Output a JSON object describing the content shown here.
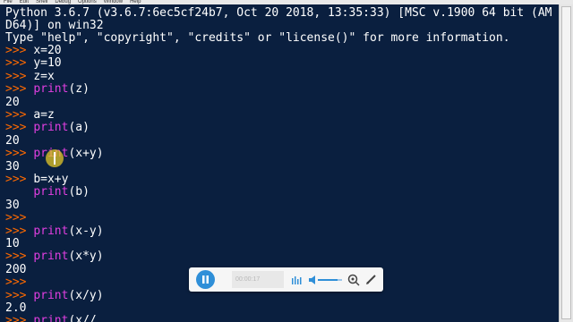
{
  "menubar": {
    "items": [
      "File",
      "Edit",
      "Shell",
      "Debug",
      "Options",
      "Window",
      "Help"
    ]
  },
  "shell": {
    "banner_line1": "Python 3.6.7 (v3.6.7:6ec5cf24b7, Oct 20 2018, 13:35:33) [MSC v.1900 64 bit (AM",
    "banner_line2": "D64)] on win32",
    "banner_line3": "Type \"help\", \"copyright\", \"credits\" or \"license()\" for more information.",
    "prompt": ">>> ",
    "lines": [
      {
        "type": "input",
        "code": "x=20"
      },
      {
        "type": "input",
        "code": "y=10"
      },
      {
        "type": "input",
        "code": "z=x"
      },
      {
        "type": "input",
        "kw": "print",
        "code": "(z)"
      },
      {
        "type": "output",
        "text": "20"
      },
      {
        "type": "input",
        "code": "a=z"
      },
      {
        "type": "input",
        "kw": "print",
        "code": "(a)"
      },
      {
        "type": "output",
        "text": "20"
      },
      {
        "type": "input",
        "kw": "print",
        "code": "(x+y)"
      },
      {
        "type": "output",
        "text": "30"
      },
      {
        "type": "input",
        "code": "b=x+y"
      },
      {
        "type": "continuation",
        "kw": "print",
        "code": "(b)"
      },
      {
        "type": "output",
        "text": "30"
      },
      {
        "type": "input",
        "code": ""
      },
      {
        "type": "input",
        "kw": "print",
        "code": "(x-y)"
      },
      {
        "type": "output",
        "text": "10"
      },
      {
        "type": "input",
        "kw": "print",
        "code": "(x*y)"
      },
      {
        "type": "output",
        "text": "200"
      },
      {
        "type": "input",
        "code": ""
      },
      {
        "type": "input",
        "kw": "print",
        "code": "(x/y)"
      },
      {
        "type": "output",
        "text": "2.0"
      },
      {
        "type": "input",
        "kw": "print",
        "code": "(x//"
      }
    ]
  },
  "player": {
    "time": "00:00:17",
    "icons": [
      "pause-icon",
      "subtitle-icon",
      "volume-icon",
      "zoom-icon",
      "pen-icon"
    ]
  }
}
